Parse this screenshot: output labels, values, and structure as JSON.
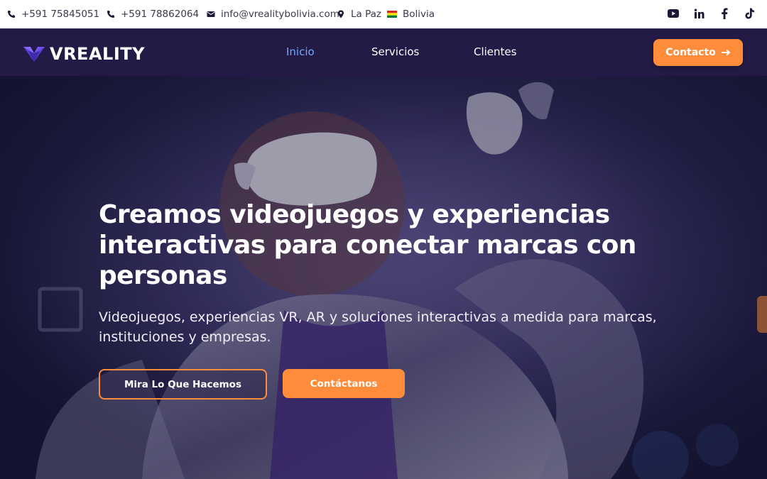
{
  "topbar": {
    "phone1": "+591 75845051",
    "phone2": "+591 78862064",
    "email": "info@vrealitybolivia.com",
    "location_city": "La Paz",
    "location_country": "Bolivia",
    "flag": "bolivia-flag",
    "socials": [
      "youtube-icon",
      "linkedin-icon",
      "facebook-icon",
      "tiktok-icon"
    ]
  },
  "navbar": {
    "logo_text": "VREALITY",
    "items": [
      {
        "label": "Inicio",
        "active": true
      },
      {
        "label": "Servicios",
        "active": false
      },
      {
        "label": "Clientes",
        "active": false
      }
    ],
    "cta_label": "Contacto",
    "cta_icon": "arrow-right-icon"
  },
  "hero": {
    "title_line1": "Creamos videojuegos y experiencias",
    "title_line2": "interactivas para conectar marcas con",
    "title_line3": "personas",
    "subtitle_line1": "Videojuegos, experiencias VR, AR y soluciones interactivas a medida para marcas,",
    "subtitle_line2": "instituciones y empresas.",
    "button_primary": "Mira Lo Que Hacemos",
    "button_secondary": "Contáctanos"
  },
  "colors": {
    "accent": "#ff8c3a",
    "nav_bg": "#231a45",
    "nav_active": "#6fa9ff",
    "logo": "#6a4bdc"
  }
}
